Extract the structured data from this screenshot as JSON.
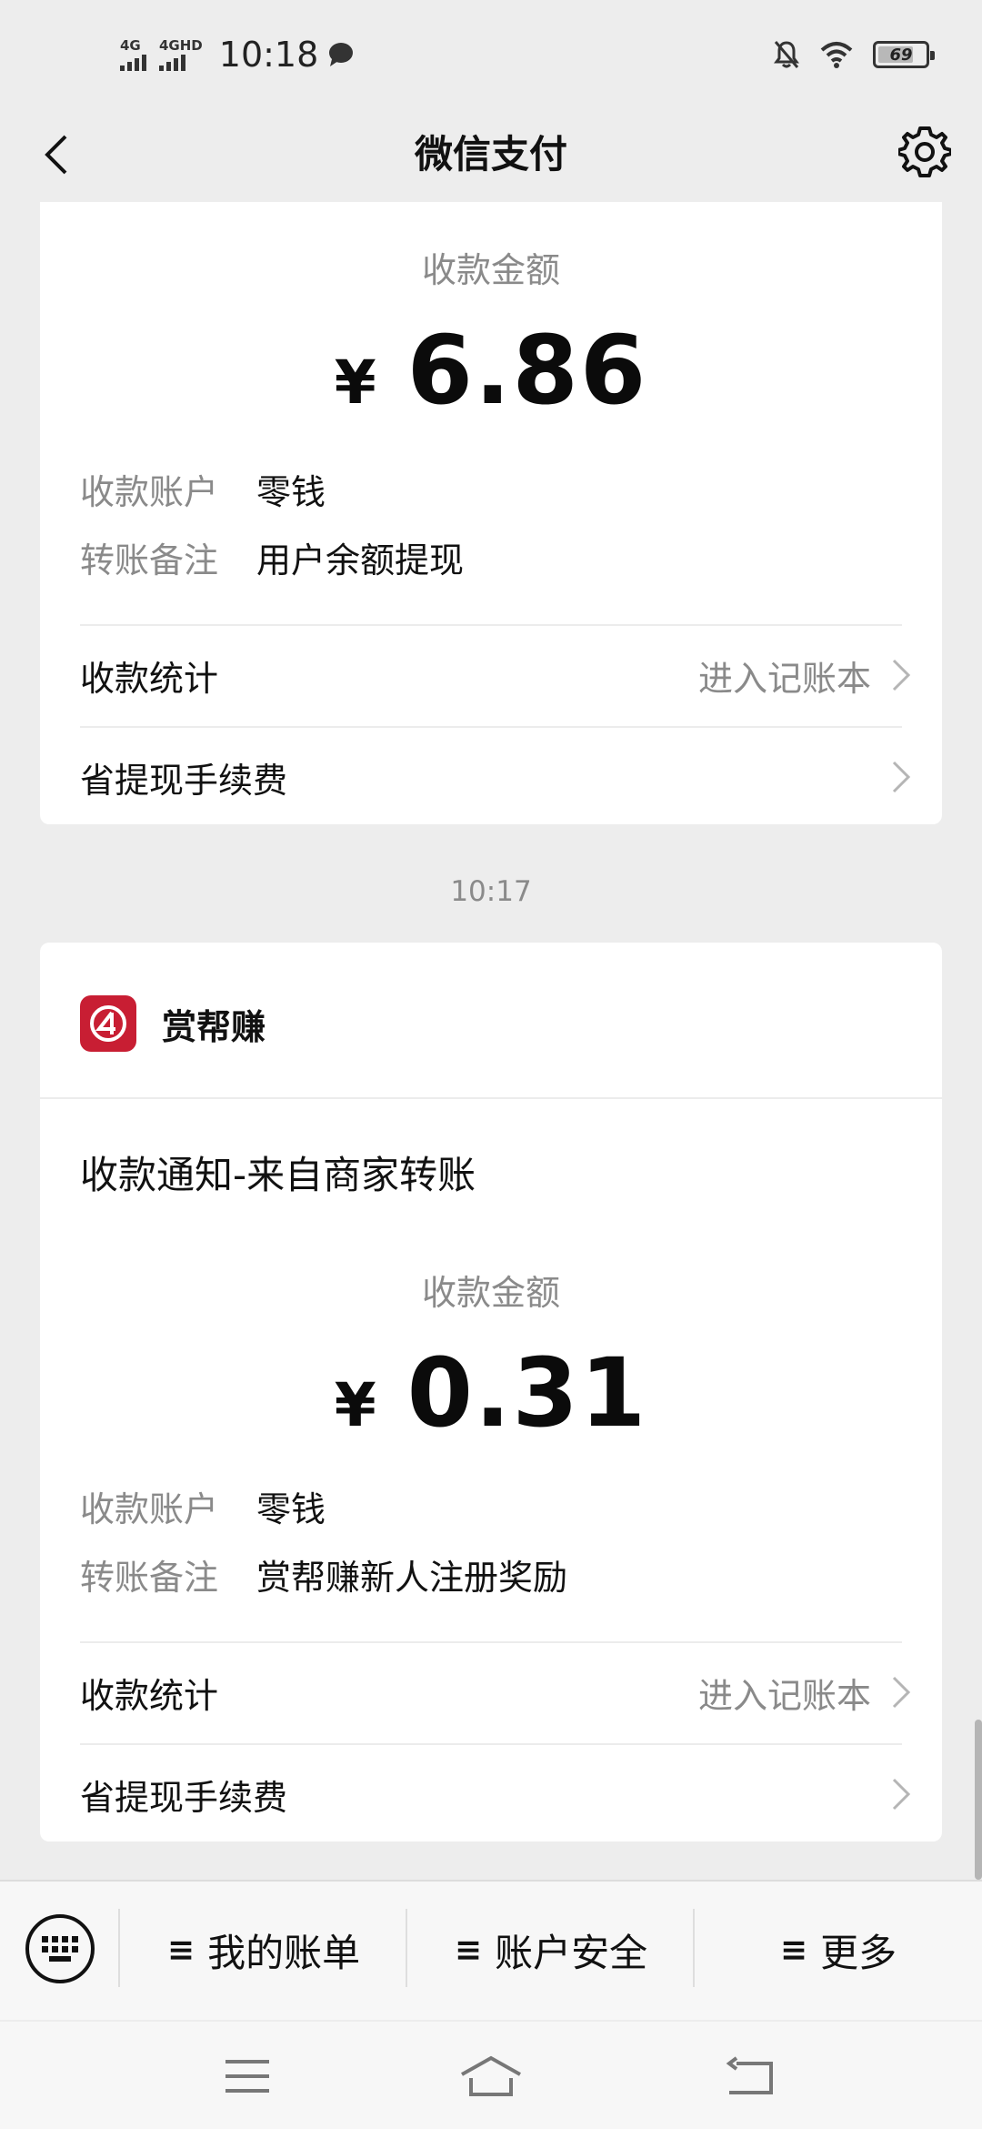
{
  "status_bar": {
    "signal1_label": "4G",
    "signal2_label": "4GHD",
    "time": "10:18",
    "battery": "69"
  },
  "nav": {
    "title": "微信支付"
  },
  "card1": {
    "amount_label": "收款金额",
    "currency": "¥",
    "amount": "6.86",
    "rows": [
      {
        "key": "收款账户",
        "value": "零钱"
      },
      {
        "key": "转账备注",
        "value": "用户余额提现"
      }
    ],
    "stats_label": "收款统计",
    "stats_link": "进入记账本",
    "fee_label": "省提现手续费"
  },
  "timestamp": "10:17",
  "card2": {
    "merchant_name": "赏帮赚",
    "notice_title": "收款通知-来自商家转账",
    "amount_label": "收款金额",
    "currency": "¥",
    "amount": "0.31",
    "rows": [
      {
        "key": "收款账户",
        "value": "零钱"
      },
      {
        "key": "转账备注",
        "value": "赏帮赚新人注册奖励"
      }
    ],
    "stats_label": "收款统计",
    "stats_link": "进入记账本",
    "fee_label": "省提现手续费"
  },
  "bottom_menu": {
    "menu_icon": "≡",
    "items": [
      {
        "label": "我的账单"
      },
      {
        "label": "账户安全"
      },
      {
        "label": "更多"
      }
    ]
  },
  "colors": {
    "background": "#ededed",
    "card": "#ffffff",
    "muted_text": "#8a8a8a",
    "merchant_logo": "#c81e33"
  }
}
